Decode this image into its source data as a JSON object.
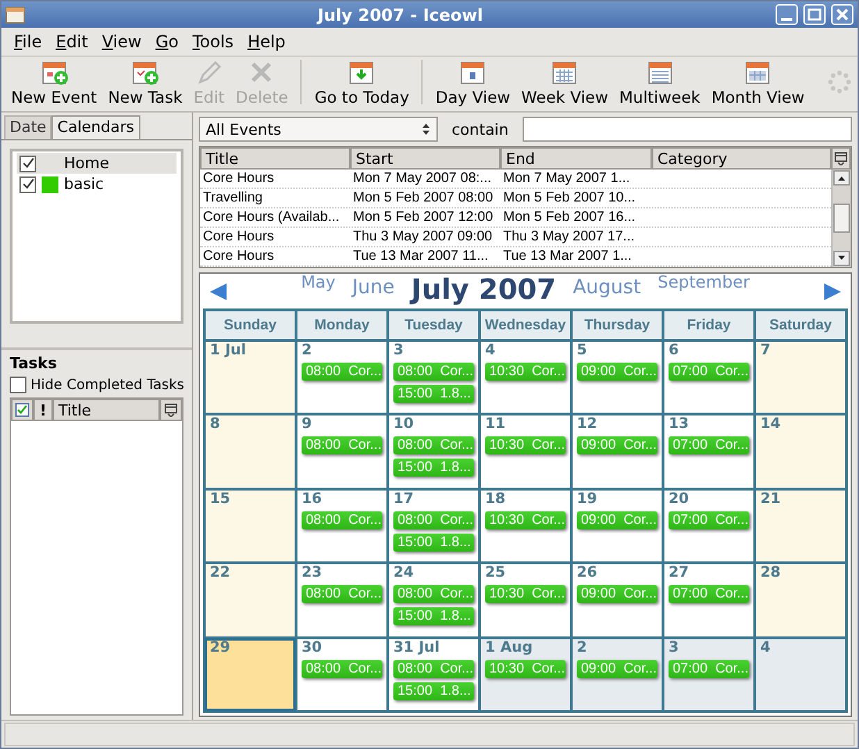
{
  "window": {
    "title": "July 2007 - Iceowl"
  },
  "menu": [
    "File",
    "Edit",
    "View",
    "Go",
    "Tools",
    "Help"
  ],
  "toolbar": [
    {
      "label": "New Event",
      "kind": "new-event",
      "disabled": false
    },
    {
      "label": "New Task",
      "kind": "new-task",
      "disabled": false
    },
    {
      "label": "Edit",
      "kind": "edit",
      "disabled": true
    },
    {
      "label": "Delete",
      "kind": "delete",
      "disabled": true
    },
    {
      "label": "Go to Today",
      "kind": "today",
      "disabled": false,
      "group_start": true
    },
    {
      "label": "Day View",
      "kind": "day",
      "disabled": false,
      "group_start": true
    },
    {
      "label": "Week View",
      "kind": "week",
      "disabled": false
    },
    {
      "label": "Multiweek",
      "kind": "multiweek",
      "disabled": false
    },
    {
      "label": "Month View",
      "kind": "month",
      "disabled": false
    }
  ],
  "sidebar": {
    "tabs": [
      {
        "label": "Date",
        "selected": false
      },
      {
        "label": "Calendars",
        "selected": true
      }
    ],
    "calendars": [
      {
        "name": "Home",
        "checked": true,
        "selected": true
      },
      {
        "name": "basic",
        "checked": true,
        "selected": false,
        "color": "#33cc00"
      }
    ],
    "tasks": {
      "title": "Tasks",
      "hide_completed": {
        "label": "Hide Completed Tasks",
        "checked": false
      },
      "columns": [
        "!",
        "Title"
      ]
    }
  },
  "filter": {
    "selection": "All Events",
    "label": "contain"
  },
  "events": {
    "columns": [
      "Title",
      "Start",
      "End",
      "Category"
    ],
    "rows": [
      {
        "title": "Core Hours",
        "start": "Mon 7 May 2007 08:...",
        "end": "Mon 7 May 2007 1..."
      },
      {
        "title": "Travelling",
        "start": "Mon 5 Feb 2007 08:00",
        "end": "Mon 5 Feb 2007 10..."
      },
      {
        "title": "Core Hours (Availab...",
        "start": "Mon 5 Feb 2007 12:00",
        "end": "Mon 5 Feb 2007 16..."
      },
      {
        "title": "Core Hours",
        "start": "Thu 3 May 2007 09:00",
        "end": "Thu 3 May 2007 17..."
      },
      {
        "title": "Core Hours",
        "start": "Tue 13 Mar 2007 11...",
        "end": "Tue 13 Mar 2007 1..."
      }
    ]
  },
  "month": {
    "title": "July 2007",
    "prev_months": [
      "May",
      "June"
    ],
    "next_months": [
      "August",
      "September"
    ],
    "weekdays": [
      "Sunday",
      "Monday",
      "Tuesday",
      "Wednesday",
      "Thursday",
      "Friday",
      "Saturday"
    ],
    "weeks": [
      [
        {
          "day": "1 Jul",
          "kind": "weekend",
          "selected": false
        },
        {
          "day": "2",
          "kind": "weekday",
          "selected": false,
          "events": [
            "08:00  Cor..."
          ]
        },
        {
          "day": "3",
          "kind": "weekday",
          "selected": false,
          "events": [
            "08:00  Cor...",
            "15:00  1.8..."
          ]
        },
        {
          "day": "4",
          "kind": "weekday",
          "selected": false,
          "events": [
            "10:30  Cor..."
          ]
        },
        {
          "day": "5",
          "kind": "weekday",
          "selected": false,
          "events": [
            "09:00  Cor..."
          ]
        },
        {
          "day": "6",
          "kind": "weekday",
          "selected": false,
          "events": [
            "07:00  Cor..."
          ]
        },
        {
          "day": "7",
          "kind": "weekend",
          "selected": false
        }
      ],
      [
        {
          "day": "8",
          "kind": "weekend",
          "selected": false
        },
        {
          "day": "9",
          "kind": "weekday",
          "selected": false,
          "events": [
            "08:00  Cor..."
          ]
        },
        {
          "day": "10",
          "kind": "weekday",
          "selected": false,
          "events": [
            "08:00  Cor...",
            "15:00  1.8..."
          ]
        },
        {
          "day": "11",
          "kind": "weekday",
          "selected": false,
          "events": [
            "10:30  Cor..."
          ]
        },
        {
          "day": "12",
          "kind": "weekday",
          "selected": false,
          "events": [
            "09:00  Cor..."
          ]
        },
        {
          "day": "13",
          "kind": "weekday",
          "selected": false,
          "events": [
            "07:00  Cor..."
          ]
        },
        {
          "day": "14",
          "kind": "weekend",
          "selected": false
        }
      ],
      [
        {
          "day": "15",
          "kind": "weekend",
          "selected": false
        },
        {
          "day": "16",
          "kind": "weekday",
          "selected": false,
          "events": [
            "08:00  Cor..."
          ]
        },
        {
          "day": "17",
          "kind": "weekday",
          "selected": false,
          "events": [
            "08:00  Cor...",
            "15:00  1.8..."
          ]
        },
        {
          "day": "18",
          "kind": "weekday",
          "selected": false,
          "events": [
            "10:30  Cor..."
          ]
        },
        {
          "day": "19",
          "kind": "weekday",
          "selected": false,
          "events": [
            "09:00  Cor..."
          ]
        },
        {
          "day": "20",
          "kind": "weekday",
          "selected": false,
          "events": [
            "07:00  Cor..."
          ]
        },
        {
          "day": "21",
          "kind": "weekend",
          "selected": false
        }
      ],
      [
        {
          "day": "22",
          "kind": "weekend",
          "selected": false
        },
        {
          "day": "23",
          "kind": "weekday",
          "selected": false,
          "events": [
            "08:00  Cor..."
          ]
        },
        {
          "day": "24",
          "kind": "weekday",
          "selected": false,
          "events": [
            "08:00  Cor...",
            "15:00  1.8..."
          ]
        },
        {
          "day": "25",
          "kind": "weekday",
          "selected": false,
          "events": [
            "10:30  Cor..."
          ]
        },
        {
          "day": "26",
          "kind": "weekday",
          "selected": false,
          "events": [
            "09:00  Cor..."
          ]
        },
        {
          "day": "27",
          "kind": "weekday",
          "selected": false,
          "events": [
            "07:00  Cor..."
          ]
        },
        {
          "day": "28",
          "kind": "weekend",
          "selected": false
        }
      ],
      [
        {
          "day": "29",
          "kind": "weekend",
          "selected": true
        },
        {
          "day": "30",
          "kind": "weekday",
          "selected": false,
          "events": [
            "08:00  Cor..."
          ]
        },
        {
          "day": "31 Jul",
          "kind": "weekday",
          "selected": false,
          "events": [
            "08:00  Cor...",
            "15:00  1.8..."
          ]
        },
        {
          "day": "1 Aug",
          "kind": "other",
          "selected": false,
          "events": [
            "10:30  Cor..."
          ]
        },
        {
          "day": "2",
          "kind": "other",
          "selected": false,
          "events": [
            "09:00  Cor..."
          ]
        },
        {
          "day": "3",
          "kind": "other",
          "selected": false,
          "events": [
            "07:00  Cor..."
          ]
        },
        {
          "day": "4",
          "kind": "other",
          "selected": false
        }
      ]
    ]
  }
}
